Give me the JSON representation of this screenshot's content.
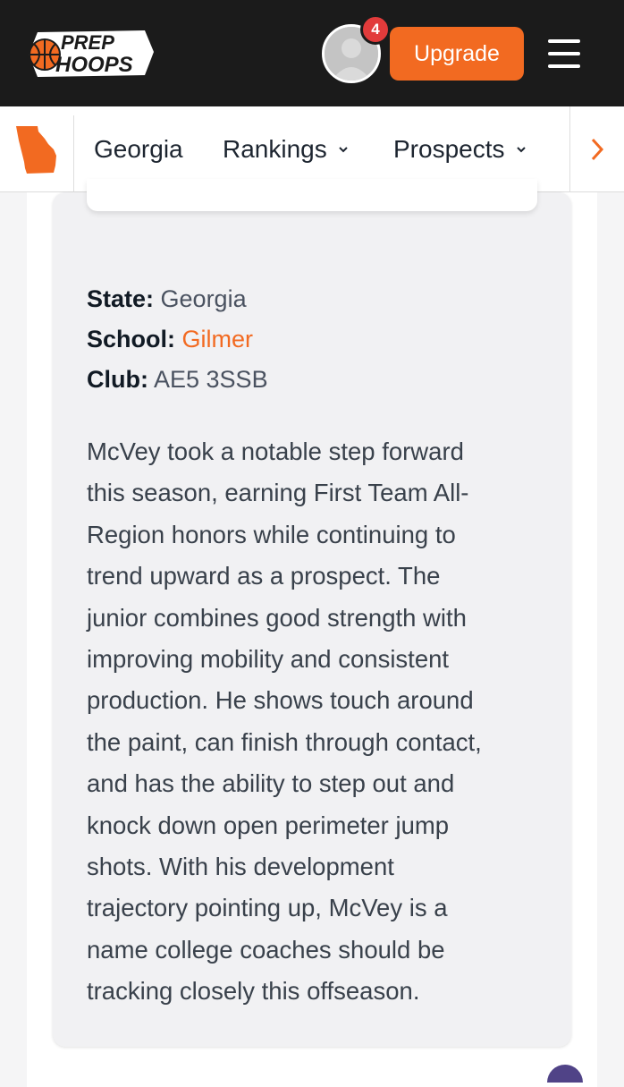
{
  "header": {
    "logo_line1": "PREP",
    "logo_line2": "HOOPS",
    "notification_count": "4",
    "upgrade_label": "Upgrade",
    "menu_icon": "hamburger-icon",
    "avatar_icon": "user-avatar-icon"
  },
  "subnav": {
    "state_icon": "georgia-state-icon",
    "items": [
      {
        "label": "Georgia"
      },
      {
        "label": "Rankings",
        "icon": "chevron-down-icon"
      },
      {
        "label": "Prospects",
        "icon": "chevron-down-icon"
      }
    ],
    "next_icon": "chevron-right-icon"
  },
  "profile": {
    "state_label": "State:",
    "state_value": "Georgia",
    "school_label": "School:",
    "school_value": "Gilmer",
    "club_label": "Club:",
    "club_value": "AE5 3SSB",
    "bio_lines": [
      "McVey took a notable step forward",
      "this season, earning First Team All-",
      "Region honors while continuing to",
      "trend upward as a prospect. The",
      "junior combines good strength with",
      "improving mobility and consistent",
      "production. He shows touch around",
      "the paint, can finish through contact,",
      "and has the ability to step out and",
      "knock down open perimeter jump",
      "shots. With his development",
      "trajectory pointing up, McVey is a",
      "name college coaches should be",
      "tracking closely this offseason."
    ]
  },
  "colors": {
    "brand_orange": "#f26a21",
    "header_bg": "#1b1b1b",
    "badge_red": "#e23b3b",
    "card_bg": "#f1f1f3"
  }
}
